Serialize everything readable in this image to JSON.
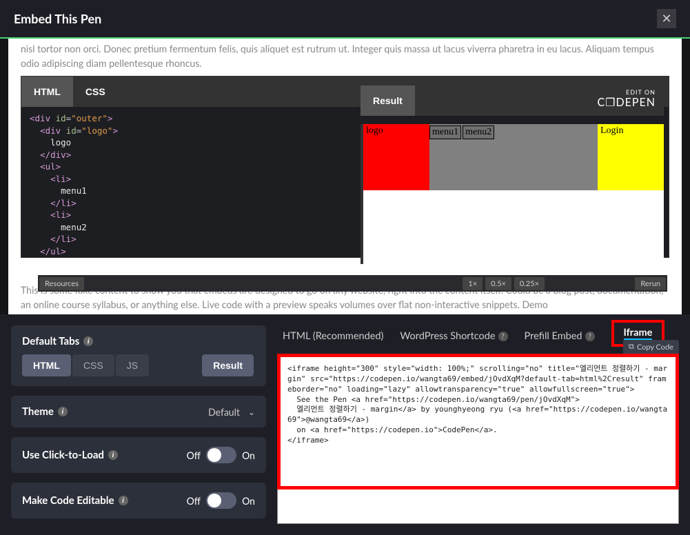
{
  "modal": {
    "title": "Embed This Pen"
  },
  "preview": {
    "textTop": "nisl tortor non orci. Donec pretium fermentum felis, quis aliquet est rutrum ut. Integer quis massa ut lacus viverra pharetra in eu lacus. Aliquam tempus odio adipiscing diam pellentesque rhoncus.",
    "textBottom": "This is some fake content to show you that embeds are designed to go on any website, right into the content itself. Could be a blog post, documentation, an online course syllabus, or anything else. Live code with a preview speaks volumes over flat non-interactive snippets. Demo"
  },
  "embed": {
    "tabs": {
      "html": "HTML",
      "css": "CSS",
      "result": "Result"
    },
    "editOn": "EDIT ON",
    "logo": "C❐DEPEN",
    "footer": {
      "resources": "Resources",
      "s1": "1×",
      "s2": "0.5×",
      "s3": "0.25×",
      "rerun": "Rerun"
    },
    "resultContent": {
      "logo": "logo",
      "menu1": "menu1",
      "menu2": "menu2",
      "login": "Login"
    }
  },
  "settings": {
    "defaultTabs": {
      "label": "Default Tabs",
      "html": "HTML",
      "css": "CSS",
      "js": "JS",
      "result": "Result"
    },
    "theme": {
      "label": "Theme",
      "value": "Default"
    },
    "clickToLoad": {
      "label": "Use Click-to-Load",
      "off": "Off",
      "on": "On"
    },
    "editable": {
      "label": "Make Code Editable",
      "off": "Off",
      "on": "On"
    }
  },
  "output": {
    "tabs": {
      "html": "HTML (Recommended)",
      "wp": "WordPress Shortcode",
      "prefill": "Prefill Embed",
      "iframe": "Iframe"
    },
    "copy": "Copy Code",
    "code": "<iframe height=\"300\" style=\"width: 100%;\" scrolling=\"no\" title=\"엘리먼트 정렬하기 - margin\" src=\"https://codepen.io/wangta69/embed/jOvdXqM?default-tab=html%2Cresult\" frameborder=\"no\" loading=\"lazy\" allowtransparency=\"true\" allowfullscreen=\"true\">\n  See the Pen <a href=\"https://codepen.io/wangta69/pen/jOvdXqM\">\n  엘리먼트 정렬하기 - margin</a> by younghyeong ryu (<a href=\"https://codepen.io/wangta69\">@wangta69</a>)\n  on <a href=\"https://codepen.io\">CodePen</a>.\n</iframe>"
  }
}
